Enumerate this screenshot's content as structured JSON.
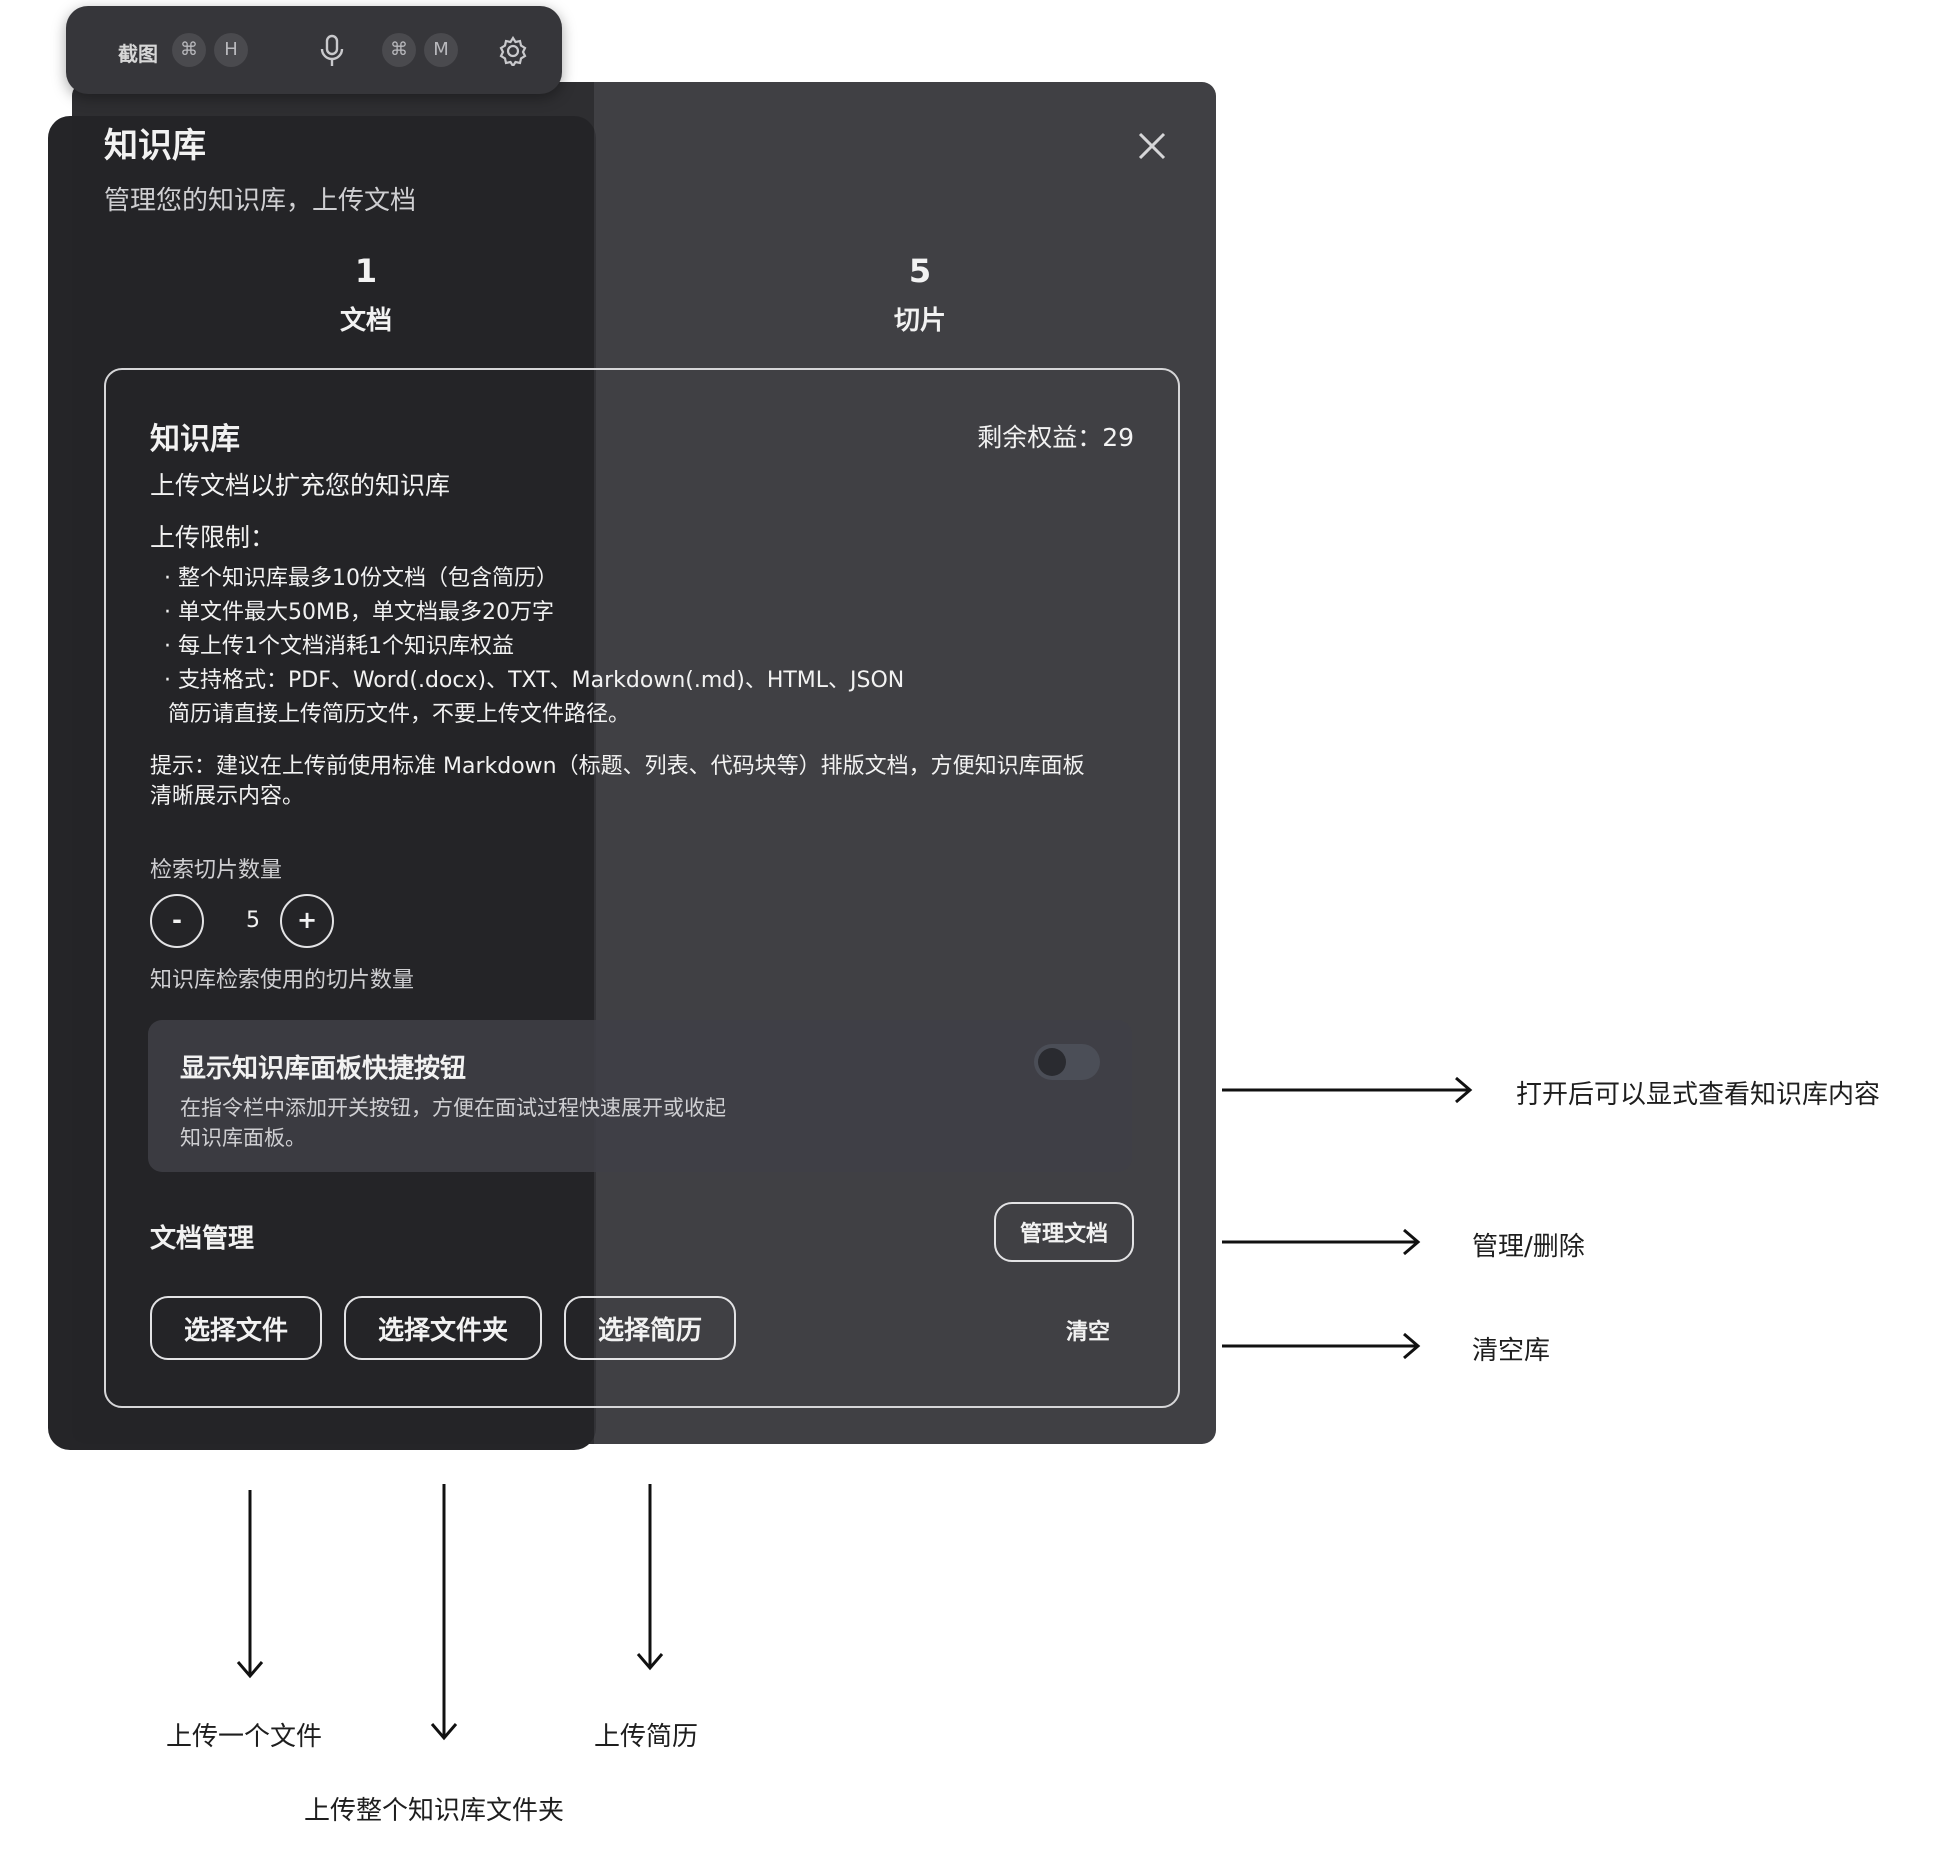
{
  "toolbar": {
    "screenshot_label": "截图",
    "screenshot_key_cmd": "⌘",
    "screenshot_key": "H",
    "mic_key_cmd": "⌘",
    "mic_key": "M",
    "icons": [
      "microphone-icon",
      "gear-icon"
    ]
  },
  "dialog": {
    "title": "知识库",
    "subtitle": "管理您的知识库，上传文档",
    "stats": [
      {
        "value": "1",
        "label": "文档"
      },
      {
        "value": "5",
        "label": "切片"
      }
    ],
    "close_icon": "close-icon"
  },
  "kb_card": {
    "title": "知识库",
    "remaining": "剩余权益：29",
    "description": "上传文档以扩充您的知识库",
    "limits_title": "上传限制：",
    "limits": [
      "· 整个知识库最多10份文档（包含简历）",
      "· 单文件最大50MB，单文档最多20万字",
      "· 每上传1个文档消耗1个知识库权益",
      "· 支持格式：PDF、Word(.docx)、TXT、Markdown(.md)、HTML、JSON"
    ],
    "resume_note": "简历请直接上传简历文件，不要上传文件路径。",
    "tip_line1": "提示：建议在上传前使用标准 Markdown（标题、列表、代码块等）排版文档，方便知识库面板",
    "tip_line2": "清晰展示内容。",
    "chunks_label": "检索切片数量",
    "chunks_minus": "-",
    "chunks_value": "5",
    "chunks_plus": "+",
    "chunks_help": "知识库检索使用的切片数量",
    "toggle_title": "显示知识库面板快捷按钮",
    "toggle_desc_line1": "在指令栏中添加开关按钮，方便在面试过程快速展开或收起",
    "toggle_desc_line2": "知识库面板。",
    "toggle_on": false,
    "doc_mgmt_label": "文档管理",
    "manage_button": "管理文档",
    "select_file_button": "选择文件",
    "select_folder_button": "选择文件夹",
    "select_resume_button": "选择简历",
    "clear_button": "清空"
  },
  "annotations": {
    "toggle_note": "打开后可以显式查看知识库内容",
    "manage_note": "管理/删除",
    "clear_note": "清空库",
    "file_note": "上传一个文件",
    "folder_note": "上传整个知识库文件夹",
    "resume_note": "上传简历"
  },
  "colors": {
    "panel": "#343438",
    "text": "#f2f2f2",
    "annotation": "#1e1e1e"
  }
}
